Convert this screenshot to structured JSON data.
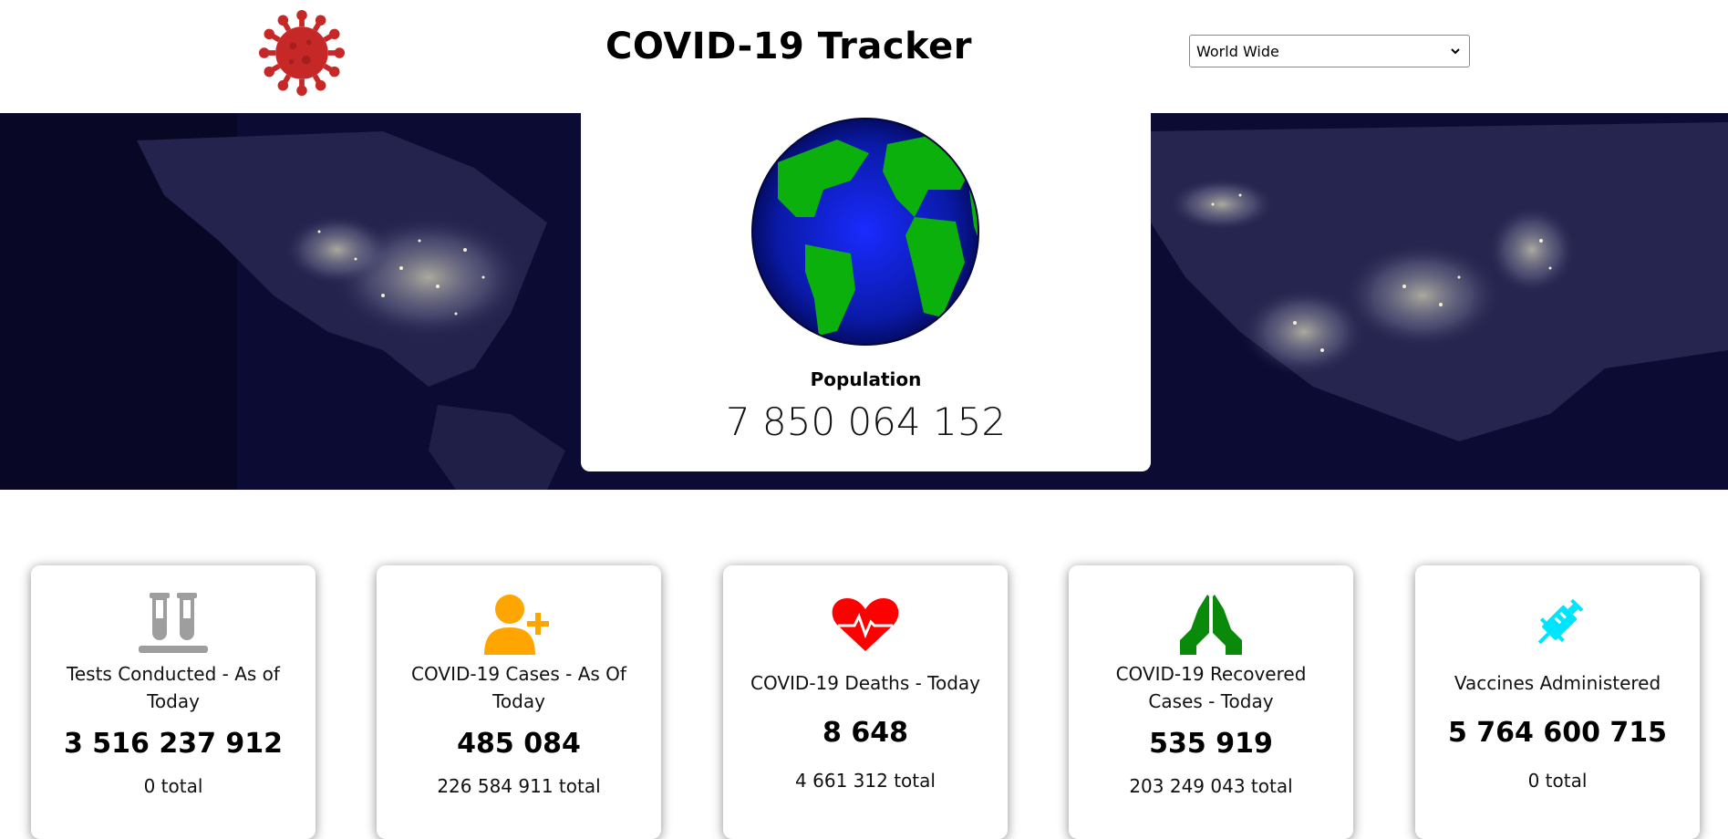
{
  "header": {
    "title": "COVID-19 Tracker",
    "logo_icon": "virus-icon",
    "logo_color": "#c62828",
    "region_select": {
      "selected": "World Wide"
    }
  },
  "population": {
    "label": "Population",
    "value": "7 850 064 152",
    "icon": "globe-icon"
  },
  "stats": [
    {
      "label": "Tests Conducted - As of Today",
      "value": "3 516 237 912",
      "total": "0 total",
      "icon": "test-tubes-icon",
      "color": "#9e9e9e"
    },
    {
      "label": "COVID-19 Cases - As Of Today",
      "value": "485 084",
      "total": "226 584 911 total",
      "icon": "user-plus-icon",
      "color": "#ffa500"
    },
    {
      "label": "COVID-19 Deaths - Today",
      "value": "8 648",
      "total": "4 661 312 total",
      "icon": "heartbeat-icon",
      "color": "#ff0000"
    },
    {
      "label": "COVID-19 Recovered Cases - Today",
      "value": "535 919",
      "total": "203 249 043 total",
      "icon": "praying-hands-icon",
      "color": "#0a8a0a"
    },
    {
      "label": "Vaccines Administered",
      "value": "5 764 600 715",
      "total": "0 total",
      "icon": "syringe-icon",
      "color": "#00e5ff"
    }
  ]
}
